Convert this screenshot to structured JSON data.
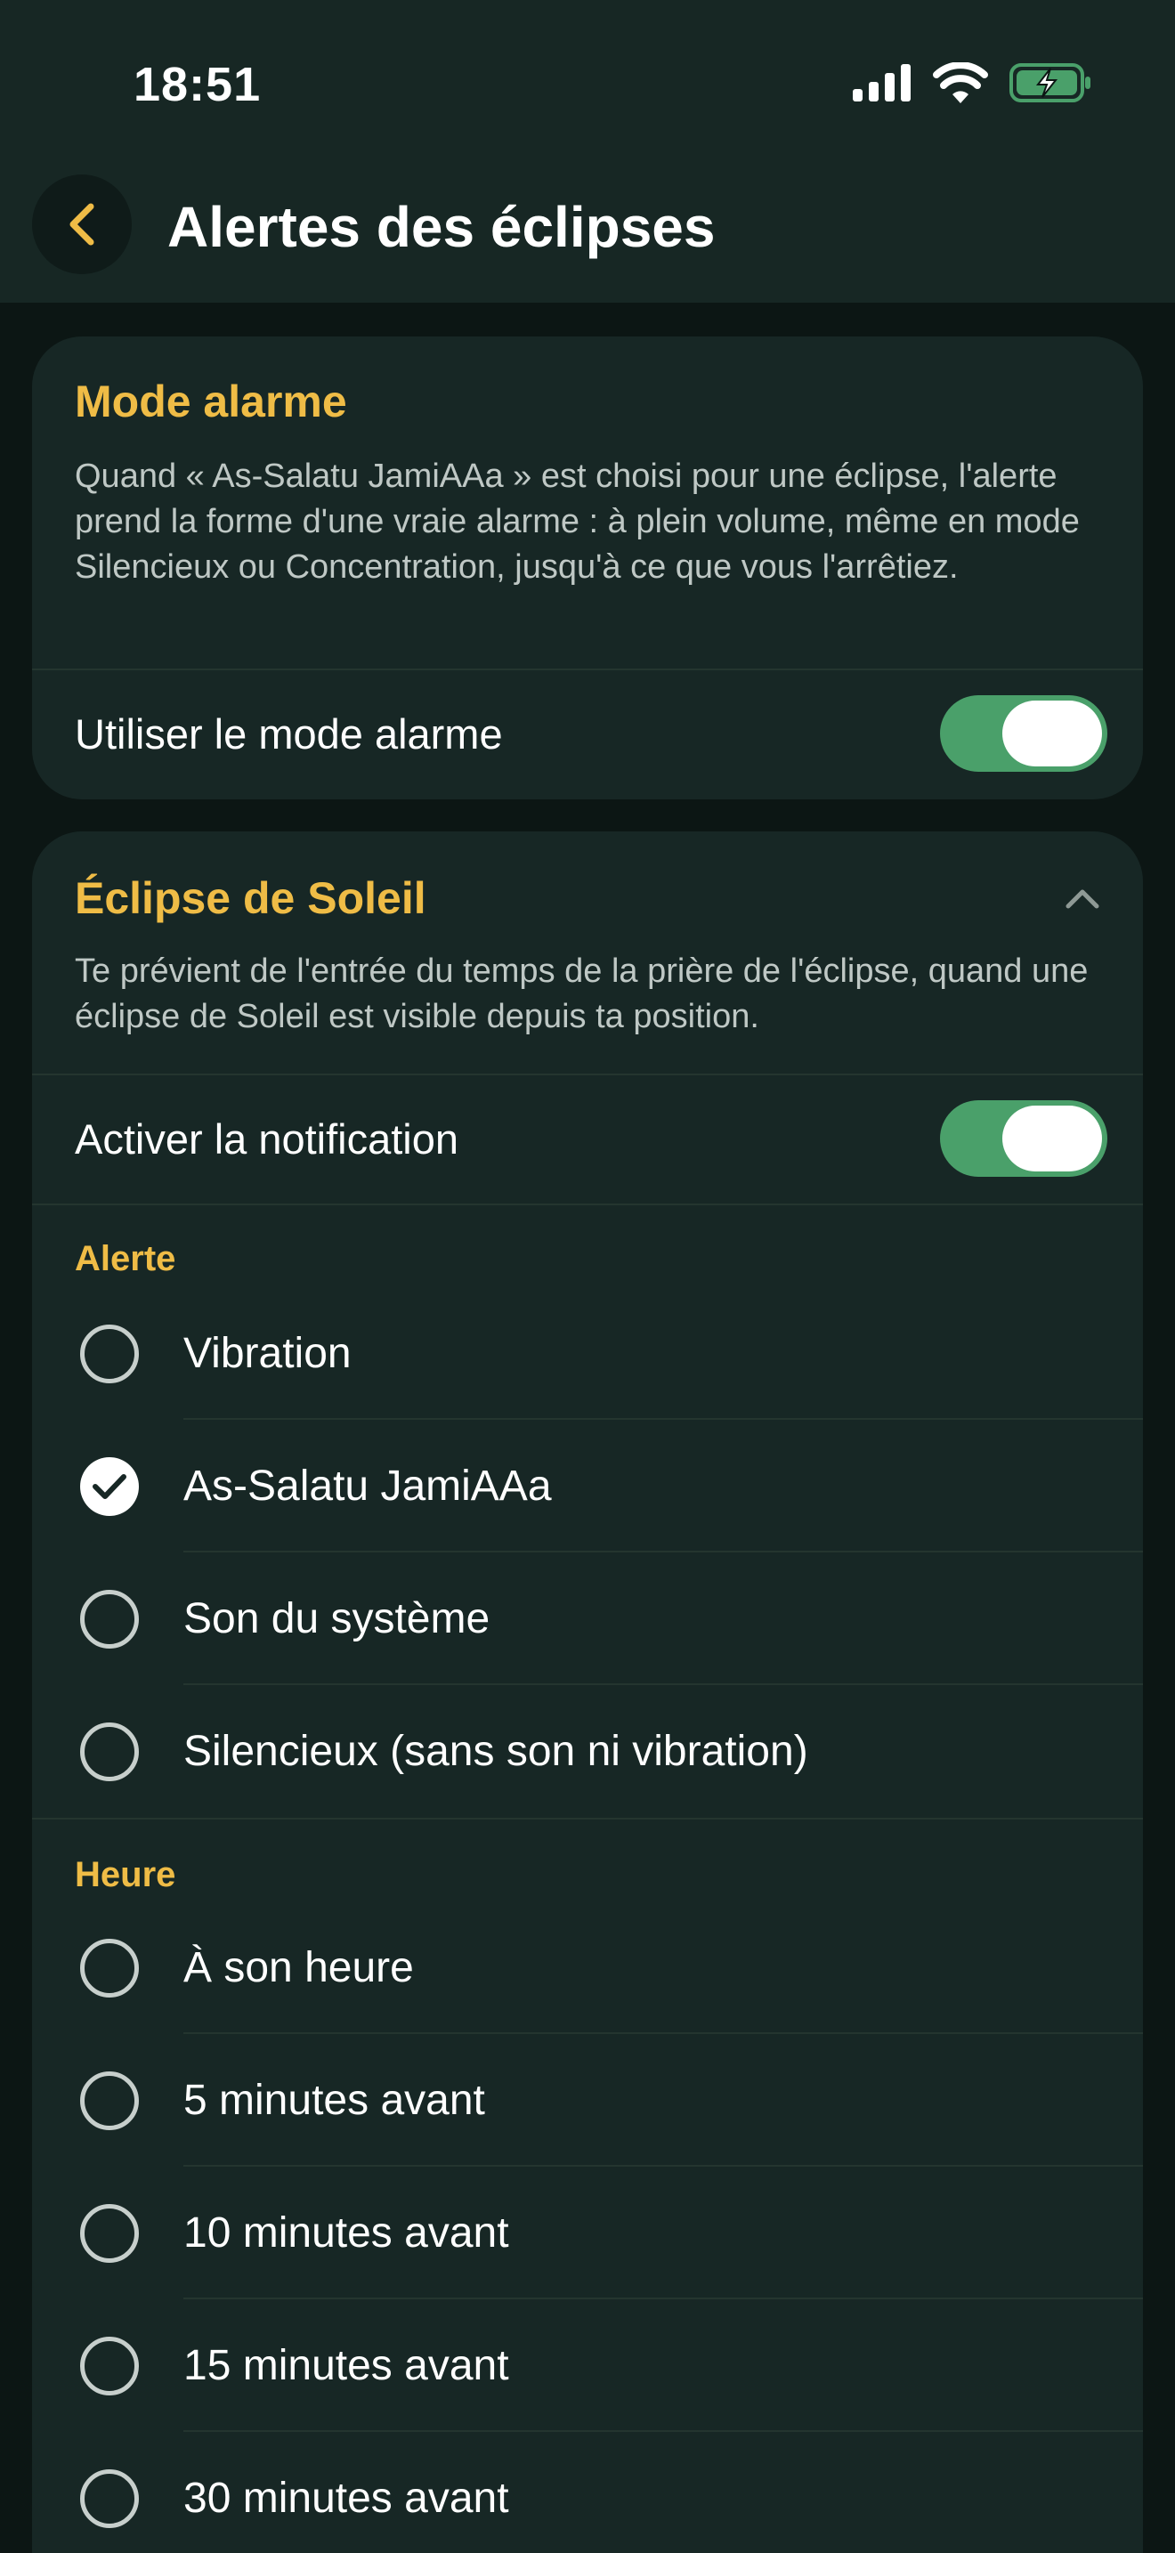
{
  "status_bar": {
    "time": "18:51"
  },
  "nav": {
    "title": "Alertes des éclipses"
  },
  "alarm_card": {
    "title": "Mode alarme",
    "description": "Quand « As-Salatu JamiAAa » est choisi pour une éclipse, l'alerte prend la forme d'une vraie alarme : à plein volume, même en mode Silencieux ou Concentration, jusqu'à ce que vous l'arrêtiez.",
    "toggle_label": "Utiliser le mode alarme",
    "toggle_on": true
  },
  "solar_card": {
    "title": "Éclipse de Soleil",
    "description": "Te prévient de l'entrée du temps de la prière de l'éclipse, quand une éclipse de Soleil est visible depuis ta position.",
    "toggle_label": "Activer la notification",
    "toggle_on": true,
    "alert_header": "Alerte",
    "alert_options": [
      {
        "label": "Vibration",
        "selected": false
      },
      {
        "label": "As-Salatu JamiAAa",
        "selected": true
      },
      {
        "label": "Son du système",
        "selected": false
      },
      {
        "label": "Silencieux (sans son ni vibration)",
        "selected": false
      }
    ],
    "time_header": "Heure",
    "time_options": [
      {
        "label": "À son heure",
        "selected": false
      },
      {
        "label": "5 minutes avant",
        "selected": false
      },
      {
        "label": "10 minutes avant",
        "selected": false
      },
      {
        "label": "15 minutes avant",
        "selected": false
      },
      {
        "label": "30 minutes avant",
        "selected": false
      }
    ]
  },
  "colors": {
    "accent": "#efbc46",
    "toggle_on": "#4aa06a",
    "card": "#172725",
    "background": "#0c1614"
  }
}
